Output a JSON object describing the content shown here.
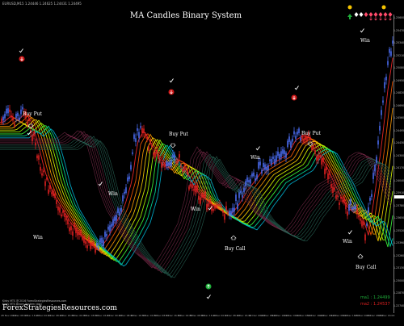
{
  "chart_header": "EURUSD,M15 1.24446 1.24625 1.24431 1.24495",
  "title": "MA Candles Binary System",
  "annotations": [
    {
      "key": "buy_put_1",
      "text": "Buy Put"
    },
    {
      "key": "buy_put_2",
      "text": "Buy Put"
    },
    {
      "key": "buy_put_3",
      "text": "Buy Put"
    },
    {
      "key": "buy_call_1",
      "text": "Buy Call"
    },
    {
      "key": "buy_call_2",
      "text": "Buy Call"
    },
    {
      "key": "win_1",
      "text": "Win"
    },
    {
      "key": "win_2",
      "text": "Win"
    },
    {
      "key": "win_3",
      "text": "Win"
    },
    {
      "key": "win_4",
      "text": "Win"
    },
    {
      "key": "win_5",
      "text": "Win"
    },
    {
      "key": "win_6",
      "text": "Win"
    }
  ],
  "ma_labels": {
    "ma1": "ma1 : 1.24499",
    "ma2": "ma2 : 1.24537"
  },
  "footer": "ForexStrategiesResources.com",
  "status_lines": [
    "Kirby MTS @ 2016 ForexStrategiesResources.com",
    "Kirby MTS Binary System (dot)"
  ],
  "price_scale": [
    "1.25600",
    "1.25470",
    "1.25340",
    "1.25210",
    "1.25080",
    "1.24950",
    "1.24820",
    "1.24690",
    "1.24560",
    "1.24495",
    "1.24430",
    "1.24300",
    "1.24170",
    "1.24040",
    "1.23910",
    "1.23780",
    "1.23650",
    "1.23520",
    "1.23390",
    "1.23260",
    "1.23130",
    "1.23000",
    "1.22870",
    "1.22740"
  ],
  "time_scale": [
    "28 Nov 2014",
    "1 Dec 08:00",
    "1 Dec 16:00",
    "2 Dec 00:00",
    "2 Dec 08:00",
    "2 Dec 16:00",
    "3 Dec 00:00",
    "3 Dec 08:00",
    "3 Dec 16:00",
    "4 Dec 00:00",
    "4 Dec 08:00",
    "4 Dec 16:00",
    "5 Dec 00:00",
    "5 Dec 08:00",
    "5 Dec 16:00",
    "8 Dec 00:00",
    "8 Dec 08:00",
    "8 Dec 16:00",
    "9 Dec 00:00",
    "9 Dec 08:00",
    "9 Dec 16:00",
    "10 Dec 00:00",
    "10 Dec 08:00",
    "10 Dec 16:00",
    "11 Dec 00:00",
    "11 Dec 08:00",
    "11 Dec 16:00",
    "12 Dec 00:00",
    "12 Dec 08:00",
    "12 Dec 16:00",
    "15 Dec 00:00",
    "15 Dec 08:00",
    "15 Dec 16:00"
  ],
  "colors": {
    "bull": "#4a6cf0",
    "bear": "#e02020",
    "up_signal": "#1fae3a",
    "down_signal": "#d01818",
    "dot": "#f5c400"
  }
}
